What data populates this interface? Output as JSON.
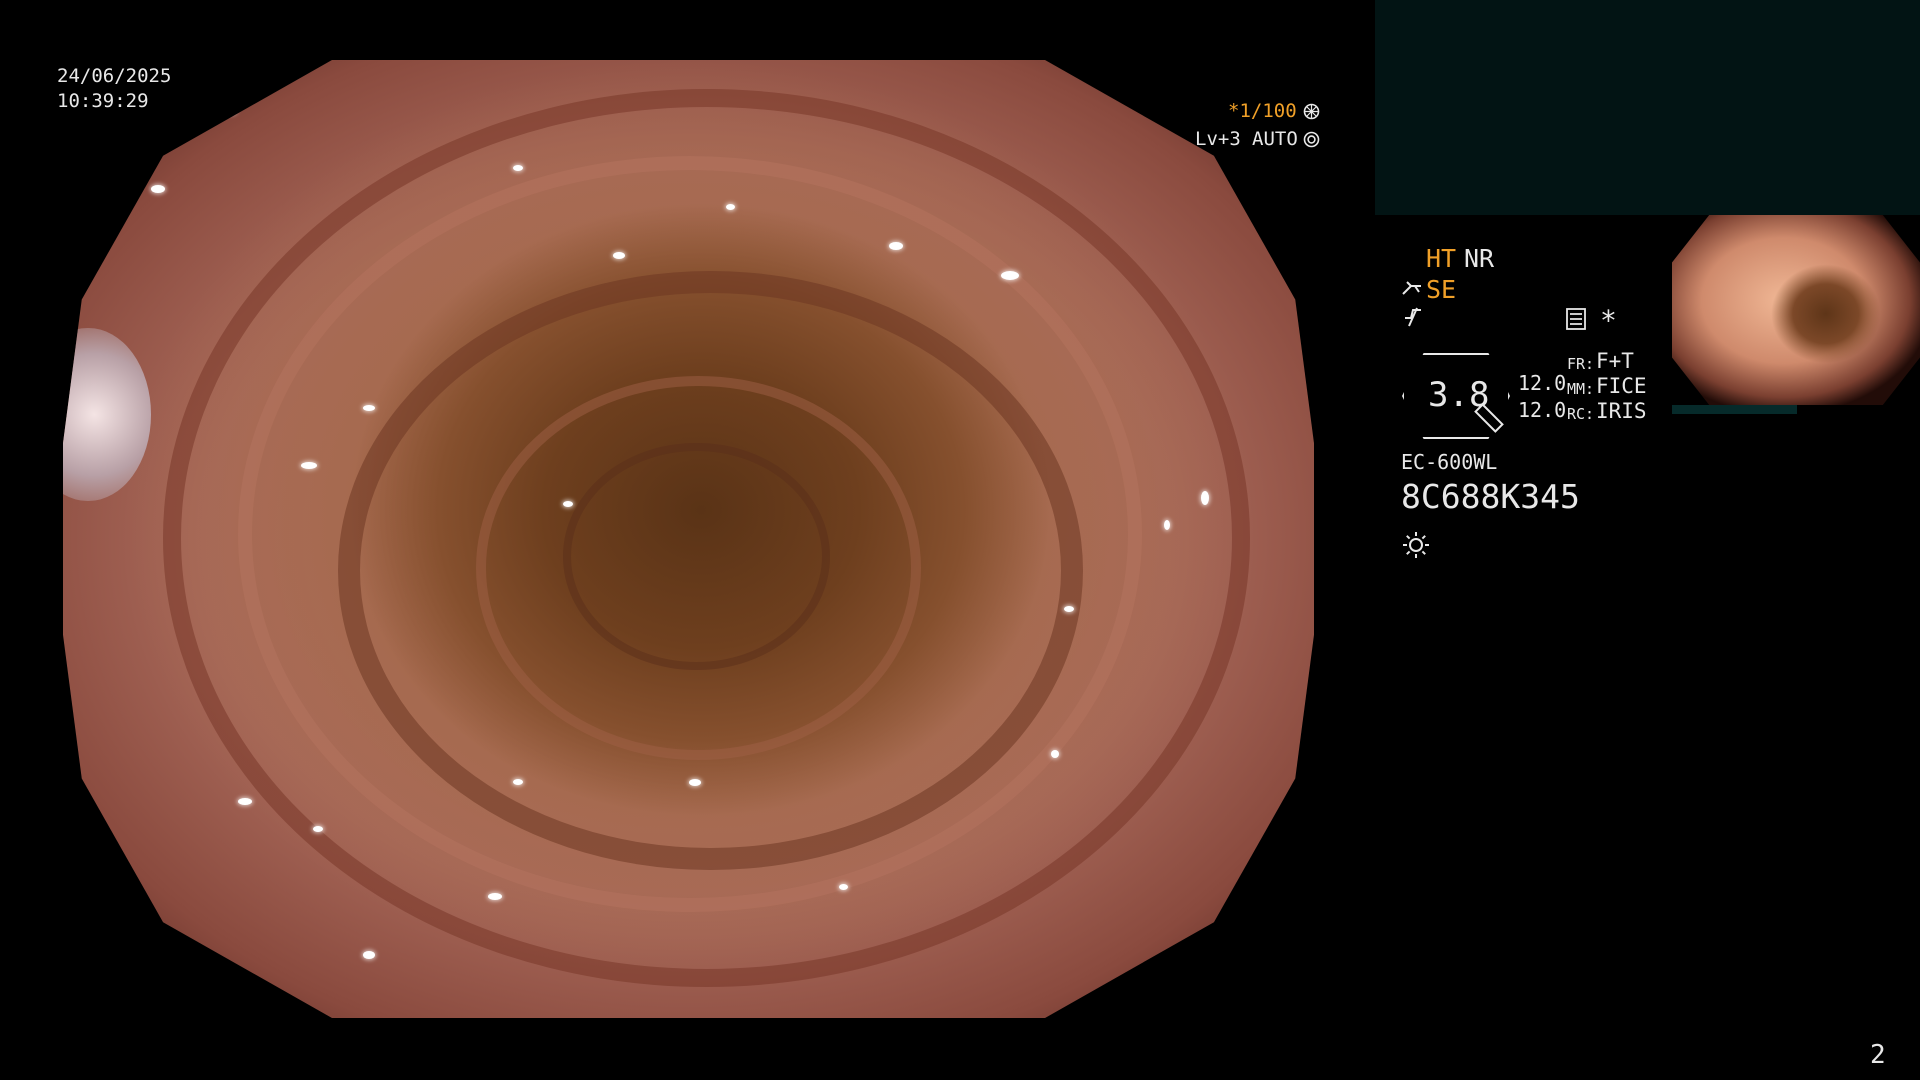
{
  "datetime": {
    "date": "24/06/2025",
    "time": "10:39:29"
  },
  "exposure": {
    "shutter": "*1/100",
    "level": "Lv+3",
    "mode": "AUTO"
  },
  "panel": {
    "ht": "HT",
    "nr": "NR",
    "se": "SE",
    "zoom": "3.8",
    "val1": "12.0",
    "val2": "12.0",
    "fr_label": "FR:",
    "fr_value": "F+T",
    "mm_label": "MM:",
    "mm_value": "FICE",
    "rc_label": "RC:",
    "rc_value": "IRIS",
    "asterisk": "*",
    "scope_model": "EC-600WL",
    "serial": "8C688K345"
  },
  "page_number": "2",
  "icons": [
    "aperture-icon",
    "settings-icon",
    "scope-icon",
    "signal-icon",
    "menu-icon",
    "sun-icon"
  ],
  "colors": {
    "accent": "#f0a028",
    "text": "#e8e8e8",
    "background": "#000000",
    "panel_box": "#021414"
  }
}
